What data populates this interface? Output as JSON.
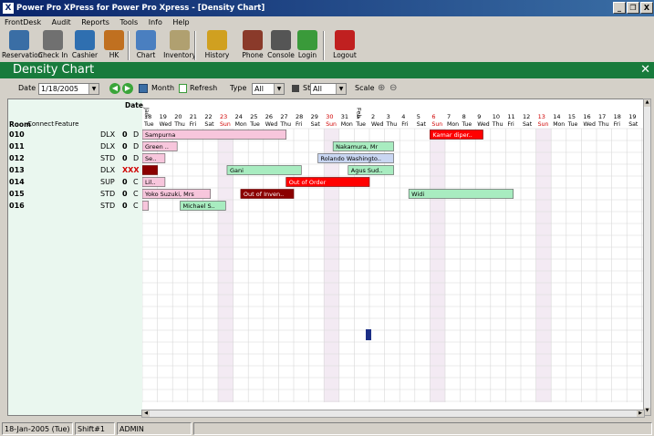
{
  "window": {
    "title": "Power Pro XPress for Power Pro Xpress - [Density Chart]",
    "min": "_",
    "max": "❐",
    "close": "X"
  },
  "menu": [
    "FrontDesk",
    "Audit",
    "Reports",
    "Tools",
    "Info",
    "Help"
  ],
  "toolbar": [
    {
      "label": "Reservation",
      "icon": "reservation-icon",
      "color": "#3a6ea5"
    },
    {
      "label": "Check In",
      "icon": "checkin-icon",
      "color": "#707070"
    },
    {
      "label": "Cashier",
      "icon": "cashier-icon",
      "color": "#2f6fb0"
    },
    {
      "label": "HK",
      "icon": "house-icon",
      "color": "#c07020"
    },
    {
      "label": "Chart",
      "icon": "chart-icon",
      "color": "#4a7fc0"
    },
    {
      "label": "Inventory",
      "icon": "inventory-icon",
      "color": "#b0a070"
    },
    {
      "label": "History",
      "icon": "history-icon",
      "color": "#d0a020"
    },
    {
      "label": "Phone",
      "icon": "phone-icon",
      "color": "#8a3a2a"
    },
    {
      "label": "Console",
      "icon": "console-icon",
      "color": "#555555"
    },
    {
      "label": "Login",
      "icon": "login-icon",
      "color": "#3a9a3a"
    },
    {
      "label": "Logout",
      "icon": "logout-icon",
      "color": "#c02020"
    }
  ],
  "panel_title": "Density Chart",
  "panel_close": "✕",
  "filters": {
    "date_label": "Date",
    "date_value": "1/18/2005",
    "month_label": "Month",
    "refresh_label": "Refresh",
    "type_label": "Type",
    "type_value": "All",
    "status_label": "Status",
    "status_value": "All",
    "scale_label": "Scale"
  },
  "grid": {
    "date_header": "Date",
    "col_room": "Room",
    "col_connect": "Connect",
    "col_feature": "Feature",
    "months": [
      {
        "label": "Jan",
        "col": 0
      },
      {
        "label": "Feb",
        "col": 14
      }
    ],
    "days": [
      {
        "d": "18",
        "w": "Tue"
      },
      {
        "d": "19",
        "w": "Wed"
      },
      {
        "d": "20",
        "w": "Thu"
      },
      {
        "d": "21",
        "w": "Fri"
      },
      {
        "d": "22",
        "w": "Sat"
      },
      {
        "d": "23",
        "w": "Sun",
        "red": true
      },
      {
        "d": "24",
        "w": "Mon"
      },
      {
        "d": "25",
        "w": "Tue"
      },
      {
        "d": "26",
        "w": "Wed"
      },
      {
        "d": "27",
        "w": "Thu"
      },
      {
        "d": "28",
        "w": "Fri"
      },
      {
        "d": "29",
        "w": "Sat"
      },
      {
        "d": "30",
        "w": "Sun",
        "red": true
      },
      {
        "d": "31",
        "w": "Mon"
      },
      {
        "d": "1",
        "w": "Tue"
      },
      {
        "d": "2",
        "w": "Wed"
      },
      {
        "d": "3",
        "w": "Thu"
      },
      {
        "d": "4",
        "w": "Fri"
      },
      {
        "d": "5",
        "w": "Sat"
      },
      {
        "d": "6",
        "w": "Sun",
        "red": true
      },
      {
        "d": "7",
        "w": "Mon"
      },
      {
        "d": "8",
        "w": "Tue"
      },
      {
        "d": "9",
        "w": "Wed"
      },
      {
        "d": "10",
        "w": "Thu"
      },
      {
        "d": "11",
        "w": "Fri"
      },
      {
        "d": "12",
        "w": "Sat"
      },
      {
        "d": "13",
        "w": "Sun",
        "red": true
      },
      {
        "d": "14",
        "w": "Mon"
      },
      {
        "d": "15",
        "w": "Tue"
      },
      {
        "d": "16",
        "w": "Wed"
      },
      {
        "d": "17",
        "w": "Thu"
      },
      {
        "d": "18",
        "w": "Fri"
      },
      {
        "d": "19",
        "w": "Sat"
      }
    ],
    "rooms": [
      {
        "num": "010",
        "type": "DLX",
        "occ": "0",
        "flag": "D"
      },
      {
        "num": "011",
        "type": "DLX",
        "occ": "0",
        "flag": "D"
      },
      {
        "num": "012",
        "type": "STD",
        "occ": "0",
        "flag": "D"
      },
      {
        "num": "013",
        "type": "DLX",
        "occ": "XXX",
        "flag": ""
      },
      {
        "num": "014",
        "type": "SUP",
        "occ": "0",
        "flag": "C"
      },
      {
        "num": "015",
        "type": "STD",
        "occ": "0",
        "flag": "C"
      },
      {
        "num": "016",
        "type": "STD",
        "occ": "0",
        "flag": "C"
      }
    ],
    "bookings": [
      {
        "row": 0,
        "start": 0,
        "end": 9.5,
        "label": "Sampurna",
        "kind": "pink"
      },
      {
        "row": 0,
        "start": 19,
        "end": 22.5,
        "label": "Kamar diper..",
        "kind": "red"
      },
      {
        "row": 1,
        "start": 0,
        "end": 2.3,
        "label": "Green ..",
        "kind": "pink"
      },
      {
        "row": 1,
        "start": 12.6,
        "end": 16.6,
        "label": "Nakamura, Mr",
        "kind": "green"
      },
      {
        "row": 2,
        "start": 0,
        "end": 1.5,
        "label": "Se..",
        "kind": "pink"
      },
      {
        "row": 2,
        "start": 11.6,
        "end": 16.6,
        "label": "Rolando Washingto..",
        "kind": "blue"
      },
      {
        "row": 3,
        "start": 0,
        "end": 1,
        "label": "",
        "kind": "darkred"
      },
      {
        "row": 3,
        "start": 5.6,
        "end": 10.5,
        "label": "Gani",
        "kind": "green"
      },
      {
        "row": 3,
        "start": 13.6,
        "end": 16.6,
        "label": "Agus Sud..",
        "kind": "green"
      },
      {
        "row": 4,
        "start": 0,
        "end": 1.5,
        "label": "Lil..",
        "kind": "pink"
      },
      {
        "row": 4,
        "start": 9.5,
        "end": 15,
        "label": "Out of Order",
        "kind": "red"
      },
      {
        "row": 5,
        "start": 0,
        "end": 4.5,
        "label": "Yoko Suzuki, Mrs",
        "kind": "pink"
      },
      {
        "row": 5,
        "start": 6.5,
        "end": 10,
        "label": "Out of Inven..",
        "kind": "darkred"
      },
      {
        "row": 5,
        "start": 17.6,
        "end": 24.5,
        "label": "Widi",
        "kind": "green"
      },
      {
        "row": 6,
        "start": 0,
        "end": 0.4,
        "label": "",
        "kind": "pink"
      },
      {
        "row": 6,
        "start": 2.5,
        "end": 5.5,
        "label": "Michael S..",
        "kind": "green"
      }
    ]
  },
  "status": {
    "date": "18-Jan-2005 (Tue)",
    "shift": "Shift#1",
    "user": "ADMIN"
  },
  "colors": {
    "pink": "#f7c6dc",
    "green": "#a8ecc0",
    "blue": "#c9d6f2",
    "red": "#ff0000",
    "darkred": "#8b0000",
    "sunday": "#f3eaf3",
    "header_green": "#187b3c"
  }
}
